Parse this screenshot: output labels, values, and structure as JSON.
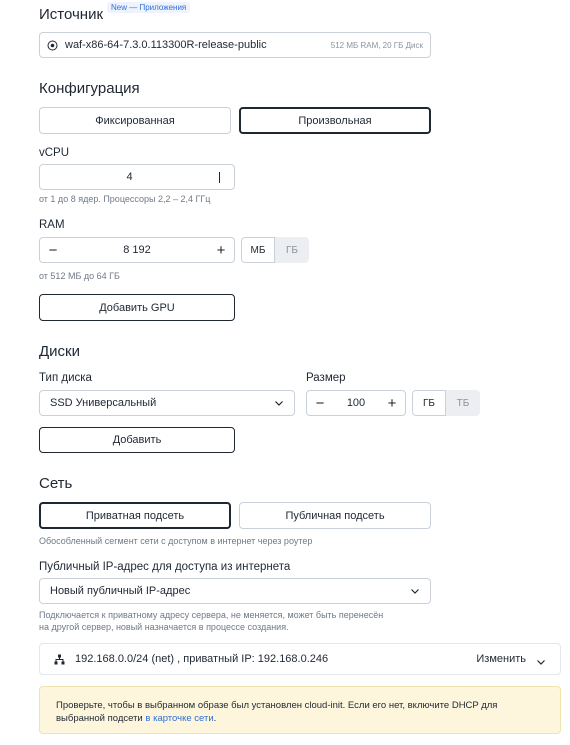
{
  "source": {
    "heading": "Источник",
    "badge": "New — Приложения",
    "image_name": "waf-x86-64-7.3.0.113300R-release-public",
    "image_spec": "512 МБ RAM, 20 ГБ Диск"
  },
  "config": {
    "heading": "Конфигурация",
    "fixed_label": "Фиксированная",
    "custom_label": "Произвольная",
    "vcpu_label": "vCPU",
    "vcpu_value": "4",
    "vcpu_hint": "от 1 до 8 ядер. Процессоры 2,2 – 2,4 ГГц",
    "ram_label": "RAM",
    "ram_minus": "−",
    "ram_value": "8 192",
    "ram_plus": "+",
    "ram_unit_mb": "МБ",
    "ram_unit_gb": "ГБ",
    "ram_hint": "от 512 МБ до 64 ГБ",
    "add_gpu_label": "Добавить GPU"
  },
  "disks": {
    "heading": "Диски",
    "type_label": "Тип диска",
    "type_value": "SSD Универсальный",
    "size_label": "Размер",
    "size_minus": "−",
    "size_value": "100",
    "size_plus": "+",
    "unit_gb": "ГБ",
    "unit_tb": "ТБ",
    "add_label": "Добавить"
  },
  "network": {
    "heading": "Сеть",
    "private_label": "Приватная подсеть",
    "public_label": "Публичная подсеть",
    "subnet_hint": "Обособленный сегмент сети с доступом в интернет через роутер",
    "public_ip_label": "Публичный IP-адрес для доступа из интернета",
    "public_ip_value": "Новый публичный IP-адрес",
    "ip_hint_line1": "Подключается к приватному адресу сервера, не меняется, может быть перенесён",
    "ip_hint_line2": "на другой сервер, новый назначается в процессе создания.",
    "net_summary": "192.168.0.0/24 (net) , приватный IP: 192.168.0.246",
    "change_label": "Изменить"
  },
  "notice": {
    "text_part1": "Проверьте, чтобы в выбранном образе был установлен cloud-init. Если его нет, включите DHCP для выбранной подсети ",
    "link_text": "в карточке сети",
    "text_part2": "."
  }
}
